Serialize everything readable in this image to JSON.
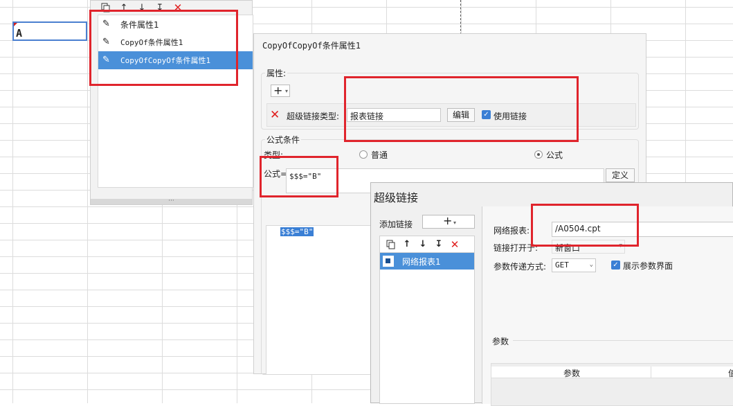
{
  "sheet": {
    "cell_value": "A"
  },
  "condition_panel": {
    "items": [
      {
        "label": "条件属性1"
      },
      {
        "label": "CopyOf条件属性1"
      },
      {
        "label": "CopyOfCopyOf条件属性1"
      }
    ],
    "resize_glyph": "···"
  },
  "property_dialog": {
    "title": "CopyOfCopyOf条件属性1",
    "attributes_label": "属性:",
    "add_glyph": "+",
    "hyperlink_type_label": "超级链接类型:",
    "hyperlink_type_value": "报表链接",
    "edit_button": "编辑",
    "use_link_label": "使用链接",
    "formula_condition_label": "公式条件",
    "type_label": "类型:",
    "radio_normal": "普通",
    "radio_formula": "公式",
    "formula_label": "公式=",
    "formula_value": "$$$=\"B\"",
    "define_button": "定义",
    "editor_text": "$$$=\"B\""
  },
  "hyperlink_dialog": {
    "title": "超级链接",
    "add_link_label": "添加链接",
    "add_glyph": "+",
    "list_items": [
      {
        "label": "网络报表1"
      }
    ],
    "web_report_label": "网络报表:",
    "web_report_value": "/A0504.cpt",
    "open_in_label": "链接打开于:",
    "open_in_value": "新窗口",
    "param_method_label": "参数传递方式:",
    "param_method_value": "GET",
    "show_param_label": "展示参数界面",
    "params_section": "参数",
    "param_col_name": "参数",
    "param_col_value": "值"
  },
  "colors": {
    "selection": "#4a90d9",
    "annotation": "#e0242c",
    "checkbox": "#3a7fd5"
  },
  "icons": [
    "copy-icon",
    "arrow-up-icon",
    "arrow-down-icon",
    "move-bottom-icon",
    "delete-icon",
    "pencil-icon",
    "report-icon",
    "checkmark-icon"
  ]
}
